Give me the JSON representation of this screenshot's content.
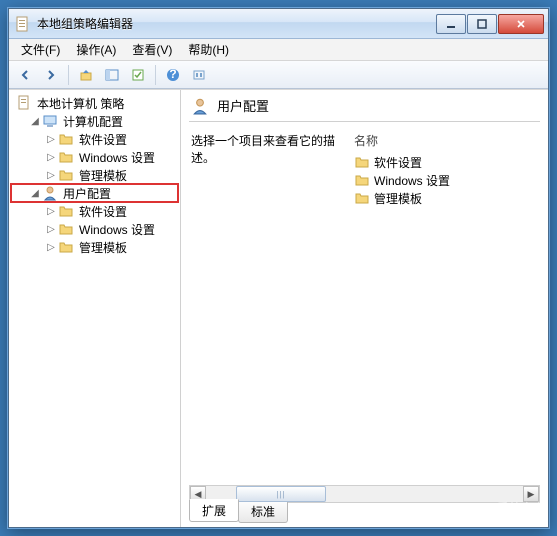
{
  "window": {
    "title": "本地组策略编辑器"
  },
  "menu": {
    "file": "文件(F)",
    "action": "操作(A)",
    "view": "查看(V)",
    "help": "帮助(H)"
  },
  "tree": {
    "root": "本地计算机 策略",
    "computer": "计算机配置",
    "user": "用户配置",
    "soft": "软件设置",
    "win": "Windows 设置",
    "admin": "管理模板"
  },
  "header": {
    "title": "用户配置"
  },
  "desc": {
    "text": "选择一个项目来查看它的描述。"
  },
  "list": {
    "col_name": "名称",
    "items": [
      {
        "label": "软件设置"
      },
      {
        "label": "Windows 设置"
      },
      {
        "label": "管理模板"
      }
    ]
  },
  "tabs": {
    "extended": "扩展",
    "standard": "标准"
  },
  "watermark": {
    "line1": "·系统之家",
    "line2": "XITONGZHIJIA"
  }
}
